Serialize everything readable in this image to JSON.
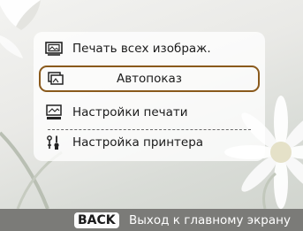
{
  "menu": {
    "items": [
      {
        "label": "Печать всех изображ.",
        "icon": "print-all-images-icon",
        "selected": false
      },
      {
        "label": "Автопоказ",
        "icon": "slideshow-icon",
        "selected": true
      },
      {
        "label": "Настройки печати",
        "icon": "print-settings-icon",
        "selected": false
      },
      {
        "label": "Настройка принтера",
        "icon": "printer-setup-icon",
        "selected": false
      }
    ]
  },
  "footer": {
    "back_key": "BACK",
    "back_text": "Выход к главному экрану"
  },
  "colors": {
    "selection_border": "#8a5a1c",
    "footer_bar": "#7b7b78"
  }
}
